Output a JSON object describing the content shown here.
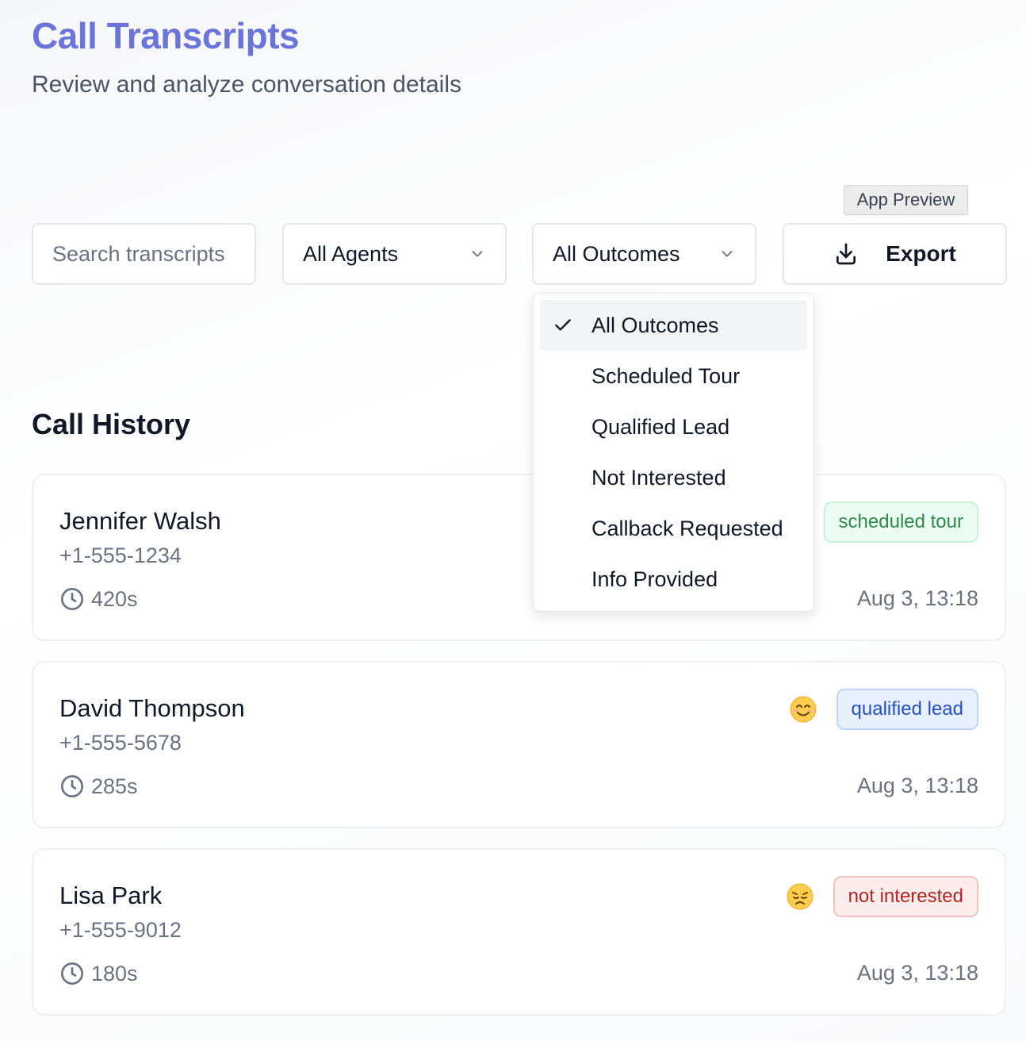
{
  "header": {
    "title": "Call Transcripts",
    "subtitle": "Review and analyze conversation details"
  },
  "app_preview_label": "App Preview",
  "filters": {
    "search_placeholder": "Search transcripts",
    "agents_select": "All Agents",
    "outcomes_select": "All Outcomes",
    "export_label": "Export"
  },
  "outcomes_dropdown": {
    "selected": "All Outcomes",
    "options": [
      "All Outcomes",
      "Scheduled Tour",
      "Qualified Lead",
      "Not Interested",
      "Callback Requested",
      "Info Provided"
    ]
  },
  "call_history": {
    "title": "Call History",
    "calls": [
      {
        "name": "Jennifer Walsh",
        "phone": "+1-555-1234",
        "duration": "420s",
        "date": "Aug 3, 13:18",
        "outcome": "scheduled tour",
        "sentiment": "hidden",
        "badge_color": "#2f8a4a"
      },
      {
        "name": "David Thompson",
        "phone": "+1-555-5678",
        "duration": "285s",
        "date": "Aug 3, 13:18",
        "outcome": "qualified lead",
        "sentiment": "smiling-face-icon",
        "badge_color": "#2350c5"
      },
      {
        "name": "Lisa Park",
        "phone": "+1-555-9012",
        "duration": "180s",
        "date": "Aug 3, 13:18",
        "outcome": "not interested",
        "sentiment": "sad-face-icon",
        "badge_color": "#b42323"
      }
    ]
  },
  "colors": {
    "title": "#6b74d9",
    "text": "#111827",
    "muted": "#6b7280"
  }
}
